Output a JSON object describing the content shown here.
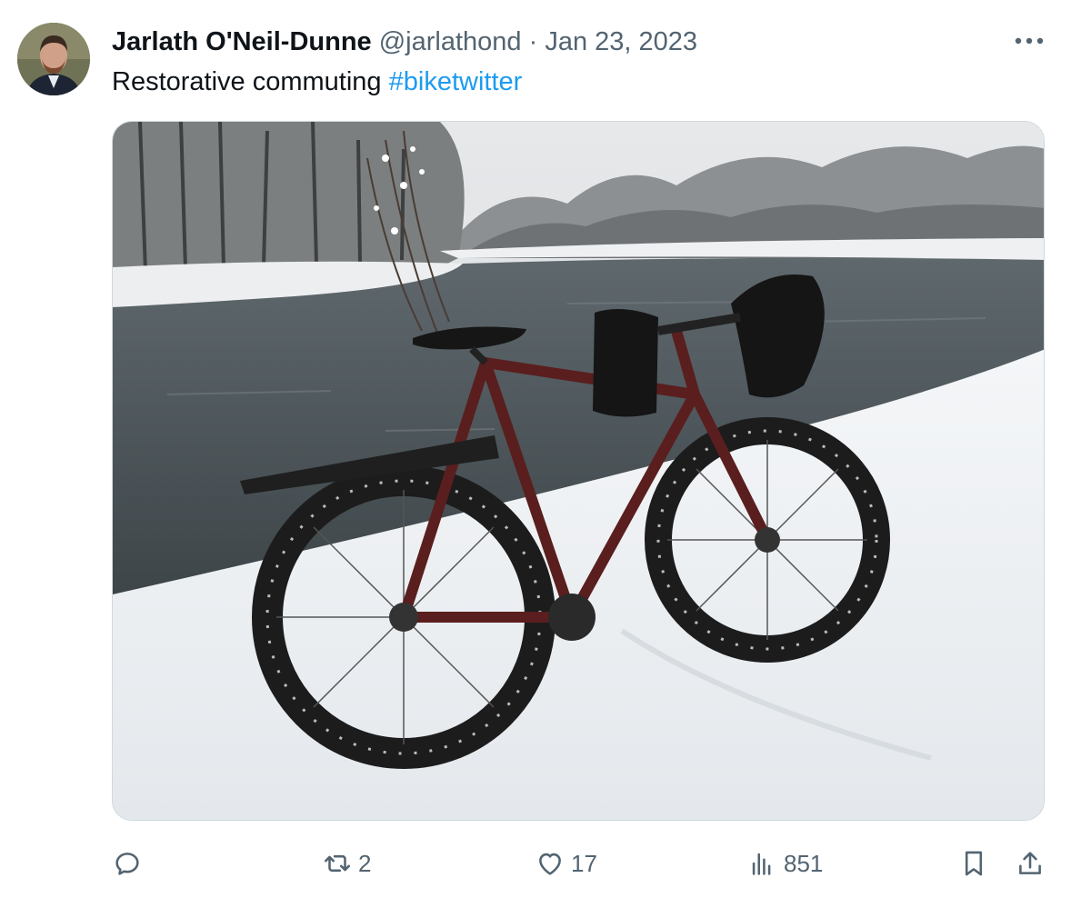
{
  "tweet": {
    "author_name": "Jarlath O'Neil-Dunne",
    "handle": "@jarlathond",
    "separator": "·",
    "date": "Jan 23, 2023",
    "text": "Restorative commuting ",
    "hashtag": "#biketwitter"
  },
  "icons": {
    "avatar": "avatar",
    "more": "more-horizontal-icon",
    "reply": "reply-icon",
    "retweet": "retweet-icon",
    "like": "heart-icon",
    "views": "views-icon",
    "bookmark": "bookmark-icon",
    "share": "share-icon"
  },
  "metrics": {
    "retweets": "2",
    "likes": "17",
    "views": "851"
  },
  "colors": {
    "text": "#0f1419",
    "secondary": "#536471",
    "link": "#1d9bf0",
    "border": "#cfd9de"
  }
}
